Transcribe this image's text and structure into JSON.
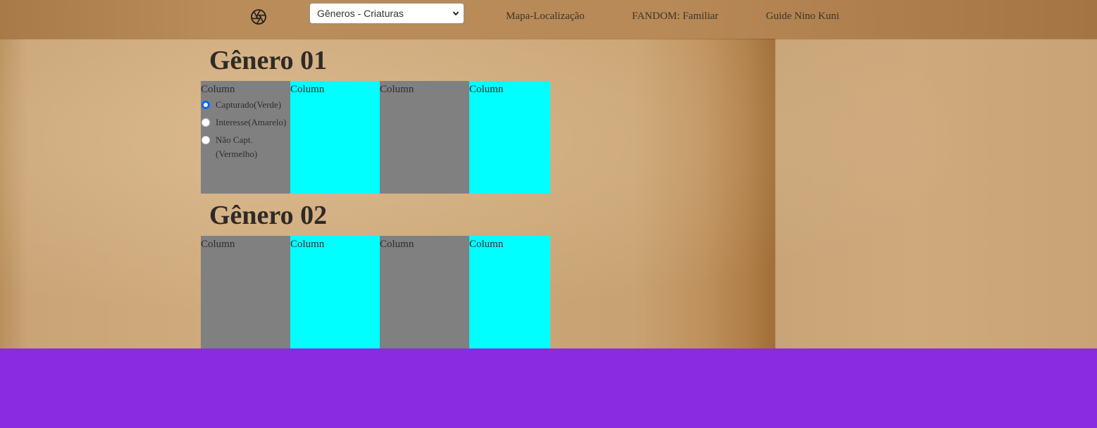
{
  "navbar": {
    "logo_icon": "aperture-icon",
    "select": {
      "selected": "Gêneros - Criaturas"
    },
    "links": [
      {
        "label": "Mapa-Localização"
      },
      {
        "label": "FANDOM: Familiar"
      },
      {
        "label": "Guide Nino Kuni"
      }
    ]
  },
  "sections": [
    {
      "title": "Gênero 01",
      "columns": [
        "Column",
        "Column",
        "Column",
        "Column"
      ],
      "radios": [
        {
          "label": "Capturado(Verde)",
          "checked": true
        },
        {
          "label": "Interesse(Amarelo)",
          "checked": false
        },
        {
          "label": "Não Capt.",
          "label2": "(Vermelho)",
          "checked": false
        }
      ]
    },
    {
      "title": "Gênero 02",
      "columns": [
        "Column",
        "Column",
        "Column",
        "Column"
      ]
    }
  ],
  "colors": {
    "gray_column": "#808080",
    "cyan_column": "#00ffff",
    "footer": "#8a2be2",
    "radio_selected": "#0a66ff"
  }
}
